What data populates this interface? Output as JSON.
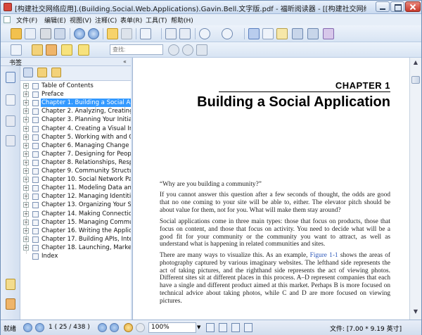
{
  "window": {
    "title": "[构建社交网络应用].(Building.Social.Web.Applications).Gavin.Bell.文字版.pdf - 福昕阅读器 - [[构建社交网络应用].(Building.Social.Web..."
  },
  "menu": [
    "文件(F)",
    "编辑(E)",
    "视图(V)",
    "注释(C)",
    "表单(R)",
    "工具(T)",
    "帮助(H)"
  ],
  "search": {
    "placeholder": "查找:"
  },
  "sidebar": {
    "title": "书签",
    "collapse": "«",
    "bookmarks": [
      {
        "label": "Table of Contents",
        "selected": false
      },
      {
        "label": "Preface",
        "selected": false
      },
      {
        "label": "Chapter 1. Building a Social Applic",
        "selected": true
      },
      {
        "label": "Chapter 2. Analyzing, Creating, ar",
        "selected": false
      },
      {
        "label": "Chapter 3. Planning Your Initial Si",
        "selected": false
      },
      {
        "label": "Chapter 4. Creating a Visual Impa",
        "selected": false
      },
      {
        "label": "Chapter 5. Working with and Cor",
        "selected": false
      },
      {
        "label": "Chapter 6. Managing Change",
        "selected": false
      },
      {
        "label": "Chapter 7. Designing for People",
        "selected": false
      },
      {
        "label": "Chapter 8. Relationships, Respons",
        "selected": false
      },
      {
        "label": "Chapter 9. Community Structures",
        "selected": false
      },
      {
        "label": "Chapter 10. Social Network Patte",
        "selected": false
      },
      {
        "label": "Chapter 11. Modeling Data and Re",
        "selected": false
      },
      {
        "label": "Chapter 12. Managing Identities",
        "selected": false
      },
      {
        "label": "Chapter 13. Organizing Your Site",
        "selected": false
      },
      {
        "label": "Chapter 14. Making Connections",
        "selected": false
      },
      {
        "label": "Chapter 15. Managing Communiti",
        "selected": false
      },
      {
        "label": "Chapter 16. Writing the Applicate",
        "selected": false
      },
      {
        "label": "Chapter 17. Building APIs, Integra",
        "selected": false
      },
      {
        "label": "Chapter 18. Launching, Marketing",
        "selected": false
      },
      {
        "label": "Index",
        "selected": false
      }
    ]
  },
  "document": {
    "chapter_label": "CHAPTER 1",
    "chapter_title": "Building a Social Application",
    "p1": "“Why are you building a community?”",
    "p2": "If you cannot answer this question after a few seconds of thought, the odds are good that no one coming to your site will be able to, either. The elevator pitch should be about value for them, not for you. What will make them stay around?",
    "p3": "Social applications come in three main types: those that focus on products, those that focus on content, and those that focus on activity. You need to decide what will be a good fit for your community or the community you want to attract, as well as understand what is happening in related communities and sites.",
    "p4_a": "There are many ways to visualize this. As an example, ",
    "p4_link": "Figure 1-1",
    "p4_b": " shows the areas of photography captured by various imaginary websites. The lefthand side represents the act of taking pictures, and the righthand side represents the act of viewing photos. Different sites sit at different places in this process. A–D represent companies that each have a single and different product aimed at this market. Perhaps B is more focused on technical advice about taking photos, while C and D are more focused on viewing pictures."
  },
  "status": {
    "ready": "就绪",
    "page": "1 ( 25 / 438 )",
    "zoom": "100%",
    "page_size": "文件: [7.00 * 9.19 英寸]"
  },
  "colors": {
    "selection": "#3399ff",
    "chrome": "#d6e2f2",
    "link": "#2a55b8"
  }
}
